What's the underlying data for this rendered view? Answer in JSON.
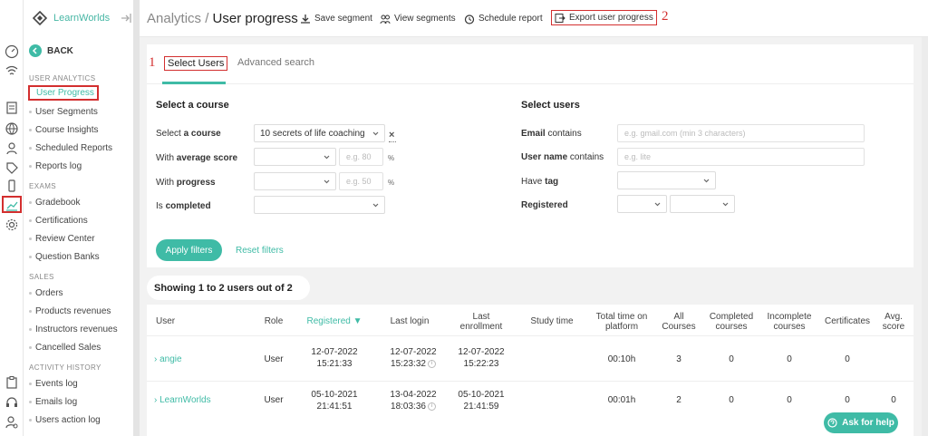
{
  "brand": {
    "name": "LearnWorlds"
  },
  "sidebar": {
    "back_label": "BACK",
    "sections": [
      {
        "title": "USER ANALYTICS",
        "items": [
          "User Progress",
          "User Segments",
          "Course Insights",
          "Scheduled Reports",
          "Reports log"
        ]
      },
      {
        "title": "EXAMS",
        "items": [
          "Gradebook",
          "Certifications",
          "Review Center",
          "Question Banks"
        ]
      },
      {
        "title": "SALES",
        "items": [
          "Orders",
          "Products revenues",
          "Instructors revenues",
          "Cancelled Sales"
        ]
      },
      {
        "title": "ACTIVITY HISTORY",
        "items": [
          "Events log",
          "Emails log",
          "Users action log"
        ]
      }
    ],
    "active_item": "User Progress"
  },
  "header": {
    "crumb_parent": "Analytics /",
    "crumb_current": "User progress",
    "actions": [
      "Save segment",
      "View segments",
      "Schedule report",
      "Export user progress"
    ],
    "annotation_markers": [
      "1",
      "2"
    ]
  },
  "tabs": [
    "Select Users",
    "Advanced search"
  ],
  "course_filters": {
    "title": "Select a course",
    "course_label_a": "Select ",
    "course_label_b": "a course",
    "course_value": "10 secrets of life coaching",
    "clear_icon": "×",
    "score_label_a": "With ",
    "score_label_b": "average score",
    "score_placeholder": "e.g. 80",
    "progress_label_a": "With ",
    "progress_label_b": "progress",
    "progress_placeholder": "e.g. 50",
    "percent": "%",
    "completed_label_a": "Is ",
    "completed_label_b": "completed"
  },
  "user_filters": {
    "title": "Select users",
    "email_label_a": "Email",
    "email_label_b": " contains",
    "email_placeholder": "e.g. gmail.com (min 3 characters)",
    "username_label_a": "User name",
    "username_label_b": " contains",
    "username_placeholder": "e.g. lite",
    "tag_label_a": "Have ",
    "tag_label_b": "tag",
    "registered_label": "Registered"
  },
  "buttons": {
    "apply": "Apply filters",
    "reset": "Reset filters",
    "help": "Ask for help"
  },
  "summary": "Showing 1 to 2 users out of 2",
  "table": {
    "columns": [
      "User",
      "Role",
      "Registered ▼",
      "Last login",
      "Last enrollment",
      "Study time",
      "Total time on platform",
      "All Courses",
      "Completed courses",
      "Incomplete courses",
      "Certificates",
      "Avg. score"
    ],
    "rows": [
      {
        "user": "› angie",
        "role": "User",
        "registered_date": "12-07-2022",
        "registered_time": "15:21:33",
        "login_date": "12-07-2022",
        "login_time": "15:23:32",
        "enroll_date": "12-07-2022",
        "enroll_time": "15:22:23",
        "study_time": "",
        "total_time": "00:10h",
        "all_courses": "3",
        "completed": "0",
        "incomplete": "0",
        "certificates": "0",
        "avg_score": ""
      },
      {
        "user": "› LearnWorlds",
        "role": "User",
        "registered_date": "05-10-2021",
        "registered_time": "21:41:51",
        "login_date": "13-04-2022",
        "login_time": "18:03:36",
        "enroll_date": "05-10-2021",
        "enroll_time": "21:41:59",
        "study_time": "",
        "total_time": "00:01h",
        "all_courses": "2",
        "completed": "0",
        "incomplete": "0",
        "certificates": "0",
        "avg_score": "0"
      }
    ]
  },
  "colors": {
    "accent": "#3fbba6",
    "highlight": "#d32f2f"
  }
}
